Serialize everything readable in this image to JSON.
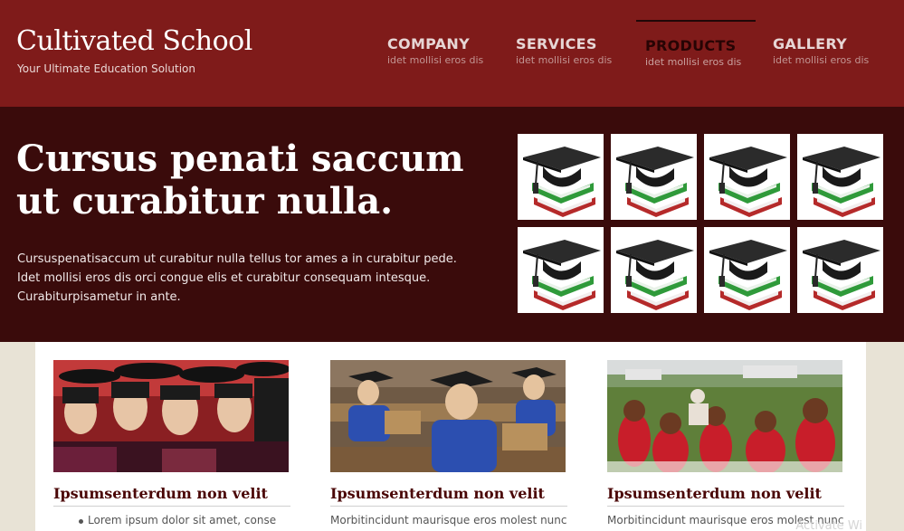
{
  "header": {
    "logo_title": "Cultivated School",
    "logo_subtitle": "Your Ultimate Education Solution"
  },
  "nav": [
    {
      "label": "COMPANY",
      "sub": "idet mollisi eros dis",
      "active": false
    },
    {
      "label": "SERVICES",
      "sub": "idet mollisi eros dis",
      "active": false
    },
    {
      "label": "PRODUCTS",
      "sub": "idet mollisi eros dis",
      "active": true
    },
    {
      "label": "GALLERY",
      "sub": "idet mollisi eros dis",
      "active": false
    }
  ],
  "hero": {
    "title": "Cursus penati saccum ut curabitur nulla.",
    "text": "Cursuspenatisaccum ut curabitur nulla tellus tor ames a in curabitur pede. Idet mollisi eros dis orci congue elis et curabitur consequam intesque. Curabiturpisametur in ante.",
    "thumbnail_icon": "graduation-cap-books-icon"
  },
  "cards": [
    {
      "title": "Ipsumsenterdum non velit",
      "list": [
        "Lorem ipsum dolor sit amet, conse"
      ],
      "image": "graduates-in-caps-photo"
    },
    {
      "title": "Ipsumsenterdum non velit",
      "text": "Morbitincidunt maurisque eros molest nunc",
      "image": "students-in-classroom-photo"
    },
    {
      "title": "Ipsumsenterdum non velit",
      "text": "Morbitincidunt maurisque eros molest nunc",
      "image": "children-celebrating-photo"
    }
  ],
  "watermark": "Activate Wi",
  "colors": {
    "header_bg": "#7f1b1a",
    "hero_bg": "#3a0b0b",
    "page_bg": "#e8e3d6",
    "card_title": "#4a0606"
  }
}
